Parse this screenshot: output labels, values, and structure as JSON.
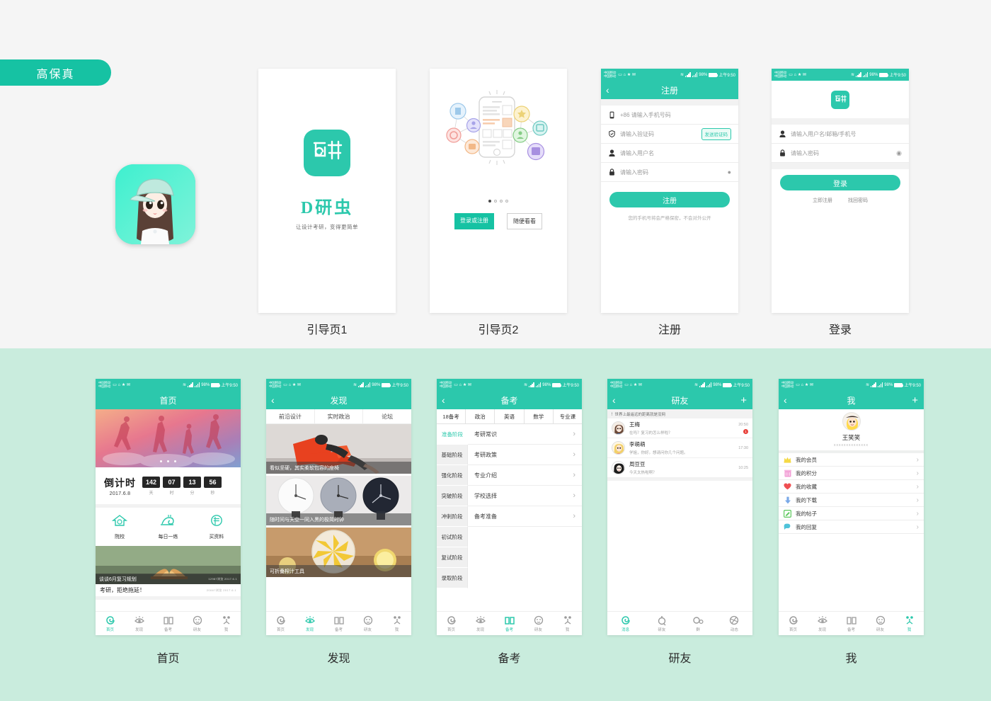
{
  "badge": {
    "label": "高保真"
  },
  "statusbar": {
    "carrier_line1": "中国移动",
    "carrier_line2": "中国移动",
    "battery": "98%",
    "time": "上午9:50"
  },
  "top_row": [
    {
      "caption": "引导页1"
    },
    {
      "caption": "引导页2"
    },
    {
      "caption": "注册"
    },
    {
      "caption": "登录"
    }
  ],
  "guide1": {
    "logo_glyph": "研",
    "brand": "D研虫",
    "tagline": "让设计考研，变得更简单"
  },
  "guide2": {
    "buttons": {
      "primary": "登录或注册",
      "secondary": "随便看看"
    },
    "dots_total": 4,
    "dots_active": 1
  },
  "register": {
    "title": "注册",
    "back_icon": "chevron-left-icon",
    "fields": [
      {
        "icon": "phone-icon",
        "placeholder": "+86 请输入手机号码",
        "action": ""
      },
      {
        "icon": "shield-icon",
        "placeholder": "请输入验证码",
        "action": "发送验证码"
      },
      {
        "icon": "user-icon",
        "placeholder": "请输入用户名",
        "action": ""
      },
      {
        "icon": "lock-icon",
        "placeholder": "请输入密码",
        "action": "eye-icon"
      }
    ],
    "submit": "注册",
    "note": "您的手机号将会严格保密，不会对外公开"
  },
  "login": {
    "logo_glyph": "研",
    "fields": [
      {
        "icon": "user-icon",
        "placeholder": "请输入用户名/邮箱/手机号"
      },
      {
        "icon": "lock-icon",
        "placeholder": "请输入密码"
      }
    ],
    "submit": "登录",
    "links": [
      "立即注册",
      "找回密码"
    ]
  },
  "bottom_row": [
    {
      "caption": "首页"
    },
    {
      "caption": "发现"
    },
    {
      "caption": "备考"
    },
    {
      "caption": "研友"
    },
    {
      "caption": "我"
    }
  ],
  "home": {
    "title": "首页",
    "countdown": {
      "label": "倒计时",
      "date": "2017.6.8",
      "values": [
        "142",
        "07",
        "13",
        "56"
      ],
      "units": [
        "天",
        "时",
        "分",
        "秒"
      ]
    },
    "quick_links": [
      {
        "icon": "school-icon",
        "label": "院校"
      },
      {
        "icon": "practice-icon",
        "label": "每日一练"
      },
      {
        "icon": "buy-material-icon",
        "label": "买资料"
      }
    ],
    "articles": [
      {
        "title": "谈谈6月复习规划",
        "meta": "12987浏览    2017.6.1"
      },
      {
        "title": "考研，拒绝拖延！",
        "meta": "20067浏览    2017.6.1"
      }
    ]
  },
  "discover": {
    "title": "发现",
    "tabs": [
      "前沿设计",
      "实时政治",
      "论坛"
    ],
    "cards": [
      {
        "caption": "看似坚硬，其实柔软包容的座椅"
      },
      {
        "caption": "随时间与天空一同入黑的极简时钟"
      },
      {
        "caption": "可折叠榨汁工具"
      }
    ]
  },
  "exam": {
    "title": "备考",
    "tabs": [
      "18备考",
      "政治",
      "英语",
      "数学",
      "专业课"
    ],
    "stages": [
      "准备阶段",
      "基础阶段",
      "强化阶段",
      "突破阶段",
      "冲刺阶段",
      "初试阶段",
      "复试阶段",
      "录取阶段"
    ],
    "stage_active": "准备阶段",
    "items": [
      "考研常识",
      "考研政策",
      "专业介绍",
      "学校选择",
      "备考准备"
    ]
  },
  "friends": {
    "title": "研友",
    "add_icon": "plus-icon",
    "notice": "！世界上最遥远的距离就是没网",
    "chats": [
      {
        "name": "王梅",
        "message": "在吗？复习的怎么样啦？",
        "time": "20:50",
        "badge": "1"
      },
      {
        "name": "李萌萌",
        "message": "学姐，你好。想请问你几个问题。",
        "time": "17:30",
        "badge": ""
      },
      {
        "name": "周豆豆",
        "message": "今天太热啦啊？",
        "time": "10:25",
        "badge": ""
      }
    ],
    "tabs": [
      "消息",
      "研友",
      "群",
      "动态"
    ],
    "tab_active": "消息"
  },
  "profile": {
    "title": "我",
    "add_icon": "plus-icon",
    "user_name": "王笑笑",
    "user_sub": "xxxxxxxxxxxxxx",
    "menu": [
      {
        "icon": "crown-icon",
        "label": "我的会员",
        "color": "#f5d945"
      },
      {
        "icon": "points-icon",
        "label": "我的积分",
        "color": "#f29bd4"
      },
      {
        "icon": "heart-icon",
        "label": "我的收藏",
        "color": "#ef4f52"
      },
      {
        "icon": "download-icon",
        "label": "我的下载",
        "color": "#7aa9e8"
      },
      {
        "icon": "post-icon",
        "label": "我的帖子",
        "color": "#5fc95f"
      },
      {
        "icon": "reply-icon",
        "label": "我的回复",
        "color": "#4fc3d9"
      }
    ]
  },
  "tabbar": {
    "items": [
      {
        "icon": "spiral-icon",
        "label": "首页"
      },
      {
        "icon": "eye-icon",
        "label": "发现"
      },
      {
        "icon": "book-icon",
        "label": "备考"
      },
      {
        "icon": "face-icon",
        "label": "研友"
      },
      {
        "icon": "person-icon",
        "label": "我"
      }
    ]
  },
  "colors": {
    "accent": "#2cc8ac",
    "badge_bg": "#16c2a3",
    "bottom_bg": "#c9ecdd",
    "page_bg": "#f5f5f5"
  }
}
